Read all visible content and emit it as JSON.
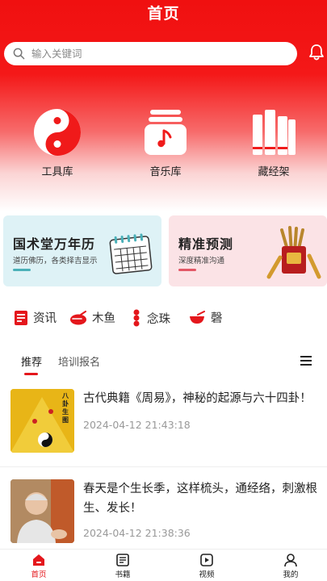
{
  "header": {
    "title": "首页"
  },
  "search": {
    "placeholder": "输入关键词"
  },
  "icons": {
    "search": "search-icon",
    "bell": "bell-icon"
  },
  "categories": [
    {
      "label": "工具库",
      "icon": "yin-yang-icon"
    },
    {
      "label": "音乐库",
      "icon": "music-jar-icon"
    },
    {
      "label": "藏经架",
      "icon": "scripture-books-icon"
    }
  ],
  "banners": [
    {
      "title": "国术堂万年历",
      "subtitle": "道历佛历，各类择吉显示",
      "icon": "calendar-icon",
      "accent": "#4ab0b8"
    },
    {
      "title": "精准预测",
      "subtitle": "深度精准沟通",
      "icon": "divination-sticks-icon",
      "accent": "#e35866"
    }
  ],
  "quick_links": [
    {
      "label": "资讯",
      "icon": "news-icon"
    },
    {
      "label": "木鱼",
      "icon": "wooden-fish-icon"
    },
    {
      "label": "念珠",
      "icon": "prayer-beads-icon"
    },
    {
      "label": "磬",
      "icon": "chime-bowl-icon"
    }
  ],
  "tabs": [
    {
      "label": "推荐",
      "active": true
    },
    {
      "label": "培训报名",
      "active": false
    }
  ],
  "articles": [
    {
      "title": "古代典籍《周易》，神秘的起源与六十四卦！",
      "time": "2024-04-12 21:43:18",
      "thumb_text": "八卦生图"
    },
    {
      "title": "春天是个生长季，这样梳头，通经络，刺激根生、发长！",
      "time": "2024-04-12 21:38:36"
    }
  ],
  "tabbar": [
    {
      "label": "首页",
      "icon": "home-icon",
      "active": true
    },
    {
      "label": "书籍",
      "icon": "book-icon",
      "active": false
    },
    {
      "label": "视频",
      "icon": "video-icon",
      "active": false
    },
    {
      "label": "我的",
      "icon": "user-icon",
      "active": false
    }
  ],
  "colors": {
    "brand": "#e4171c",
    "hero_top": "#f01010",
    "teal_banner": "#def2f6",
    "pink_banner": "#fbe3e6",
    "muted": "#999999"
  }
}
